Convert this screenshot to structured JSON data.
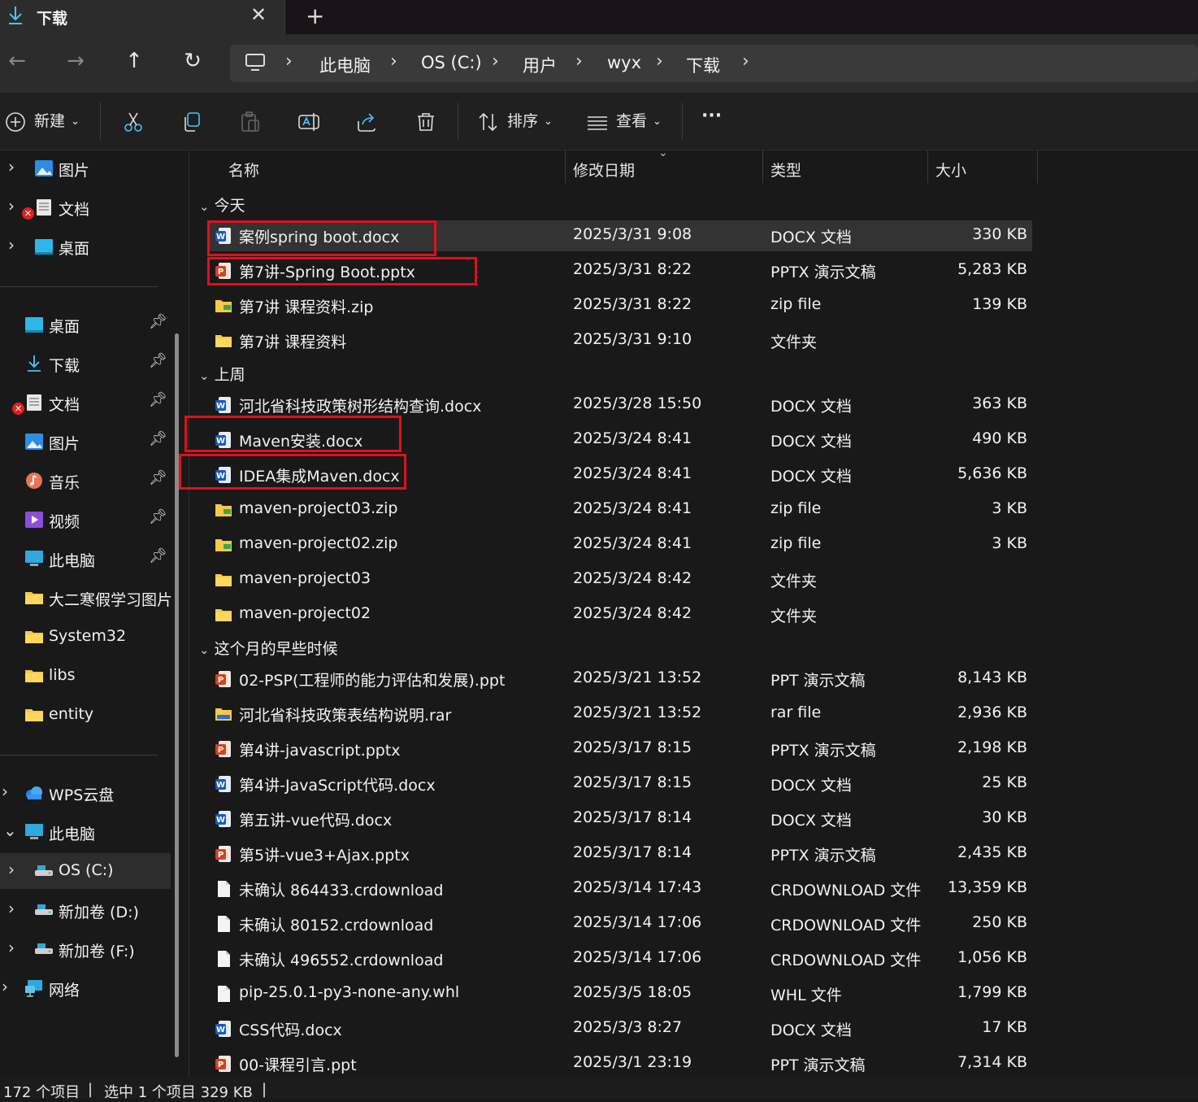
{
  "tab": {
    "title": "下载",
    "close": "✕",
    "new": "+"
  },
  "nav": {
    "back": "←",
    "forward": "→",
    "up": "↑",
    "refresh": "↻"
  },
  "breadcrumb": [
    "此电脑",
    "OS (C:)",
    "用户",
    "wyx",
    "下载"
  ],
  "toolbar": {
    "new_label": "新建",
    "sort_label": "排序",
    "view_label": "查看",
    "more": "···"
  },
  "sidebar": {
    "top": [
      {
        "label": "图片",
        "icon": "pictures-icon"
      },
      {
        "label": "文档",
        "icon": "documents-icon"
      },
      {
        "label": "桌面",
        "icon": "desktop-icon"
      }
    ],
    "quick": [
      {
        "label": "桌面",
        "icon": "desktop-icon",
        "pinned": true
      },
      {
        "label": "下载",
        "icon": "download-icon",
        "pinned": true
      },
      {
        "label": "文档",
        "icon": "documents-icon",
        "pinned": true
      },
      {
        "label": "图片",
        "icon": "pictures-icon",
        "pinned": true
      },
      {
        "label": "音乐",
        "icon": "music-icon",
        "pinned": true
      },
      {
        "label": "视频",
        "icon": "video-icon",
        "pinned": true
      },
      {
        "label": "此电脑",
        "icon": "computer-icon",
        "pinned": true
      },
      {
        "label": "大二寒假学习图片",
        "icon": "folder-icon",
        "pinned": false
      },
      {
        "label": "System32",
        "icon": "folder-icon",
        "pinned": false
      },
      {
        "label": "libs",
        "icon": "folder-icon",
        "pinned": false
      },
      {
        "label": "entity",
        "icon": "folder-icon",
        "pinned": false
      }
    ],
    "drives": [
      {
        "label": "WPS云盘",
        "icon": "cloud-icon"
      },
      {
        "label": "此电脑",
        "icon": "computer-icon"
      },
      {
        "label": "OS (C:)",
        "icon": "drive-icon"
      },
      {
        "label": "新加卷 (D:)",
        "icon": "drive-icon"
      },
      {
        "label": "新加卷 (F:)",
        "icon": "drive-icon"
      },
      {
        "label": "网络",
        "icon": "network-icon"
      }
    ]
  },
  "columns": {
    "name": "名称",
    "date": "修改日期",
    "type": "类型",
    "size": "大小"
  },
  "groups": [
    {
      "label": "今天",
      "files": [
        {
          "name": "案例spring boot.docx",
          "date": "2025/3/31 9:08",
          "type": "DOCX 文档",
          "size": "330 KB",
          "kind": "word"
        },
        {
          "name": "第7讲-Spring Boot.pptx",
          "date": "2025/3/31 8:22",
          "type": "PPTX 演示文稿",
          "size": "5,283 KB",
          "kind": "ppt"
        },
        {
          "name": "第7讲 课程资料.zip",
          "date": "2025/3/31 8:22",
          "type": "zip file",
          "size": "139 KB",
          "kind": "zip"
        },
        {
          "name": "第7讲 课程资料",
          "date": "2025/3/31 9:10",
          "type": "文件夹",
          "size": "",
          "kind": "folder"
        }
      ]
    },
    {
      "label": "上周",
      "files": [
        {
          "name": "河北省科技政策树形结构查询.docx",
          "date": "2025/3/28 15:50",
          "type": "DOCX 文档",
          "size": "363 KB",
          "kind": "word"
        },
        {
          "name": "Maven安装.docx",
          "date": "2025/3/24 8:41",
          "type": "DOCX 文档",
          "size": "490 KB",
          "kind": "word"
        },
        {
          "name": "IDEA集成Maven.docx",
          "date": "2025/3/24 8:41",
          "type": "DOCX 文档",
          "size": "5,636 KB",
          "kind": "word"
        },
        {
          "name": "maven-project03.zip",
          "date": "2025/3/24 8:41",
          "type": "zip file",
          "size": "3 KB",
          "kind": "zip"
        },
        {
          "name": "maven-project02.zip",
          "date": "2025/3/24 8:41",
          "type": "zip file",
          "size": "3 KB",
          "kind": "zip"
        },
        {
          "name": "maven-project03",
          "date": "2025/3/24 8:42",
          "type": "文件夹",
          "size": "",
          "kind": "folder"
        },
        {
          "name": "maven-project02",
          "date": "2025/3/24 8:42",
          "type": "文件夹",
          "size": "",
          "kind": "folder"
        }
      ]
    },
    {
      "label": "这个月的早些时候",
      "files": [
        {
          "name": "02-PSP(工程师的能力评估和发展).ppt",
          "date": "2025/3/21 13:52",
          "type": "PPT 演示文稿",
          "size": "8,143 KB",
          "kind": "ppt"
        },
        {
          "name": "河北省科技政策表结构说明.rar",
          "date": "2025/3/21 13:52",
          "type": "rar file",
          "size": "2,936 KB",
          "kind": "rar"
        },
        {
          "name": "第4讲-javascript.pptx",
          "date": "2025/3/17 8:15",
          "type": "PPTX 演示文稿",
          "size": "2,198 KB",
          "kind": "ppt"
        },
        {
          "name": "第4讲-JavaScript代码.docx",
          "date": "2025/3/17 8:15",
          "type": "DOCX 文档",
          "size": "25 KB",
          "kind": "word"
        },
        {
          "name": "第五讲-vue代码.docx",
          "date": "2025/3/17 8:14",
          "type": "DOCX 文档",
          "size": "30 KB",
          "kind": "word"
        },
        {
          "name": "第5讲-vue3+Ajax.pptx",
          "date": "2025/3/17 8:14",
          "type": "PPTX 演示文稿",
          "size": "2,435 KB",
          "kind": "ppt"
        },
        {
          "name": "未确认 864433.crdownload",
          "date": "2025/3/14 17:43",
          "type": "CRDOWNLOAD 文件",
          "size": "13,359 KB",
          "kind": "blank"
        },
        {
          "name": "未确认 80152.crdownload",
          "date": "2025/3/14 17:06",
          "type": "CRDOWNLOAD 文件",
          "size": "250 KB",
          "kind": "blank"
        },
        {
          "name": "未确认 496552.crdownload",
          "date": "2025/3/14 17:06",
          "type": "CRDOWNLOAD 文件",
          "size": "1,056 KB",
          "kind": "blank"
        },
        {
          "name": "pip-25.0.1-py3-none-any.whl",
          "date": "2025/3/5 18:05",
          "type": "WHL 文件",
          "size": "1,799 KB",
          "kind": "blank"
        },
        {
          "name": "CSS代码.docx",
          "date": "2025/3/3 8:27",
          "type": "DOCX 文档",
          "size": "17 KB",
          "kind": "word"
        },
        {
          "name": "00-课程引言.ppt",
          "date": "2025/3/1 23:19",
          "type": "PPT 演示文稿",
          "size": "7,314 KB",
          "kind": "ppt"
        }
      ]
    }
  ],
  "status": {
    "count": "172 个项目",
    "selected": "选中 1 个项目  329 KB"
  },
  "colors": {
    "accent": "#4cc2ff",
    "highlight": "#e0101e",
    "word": "#185abd",
    "ppt": "#d04423",
    "folder": "#f7c948"
  }
}
